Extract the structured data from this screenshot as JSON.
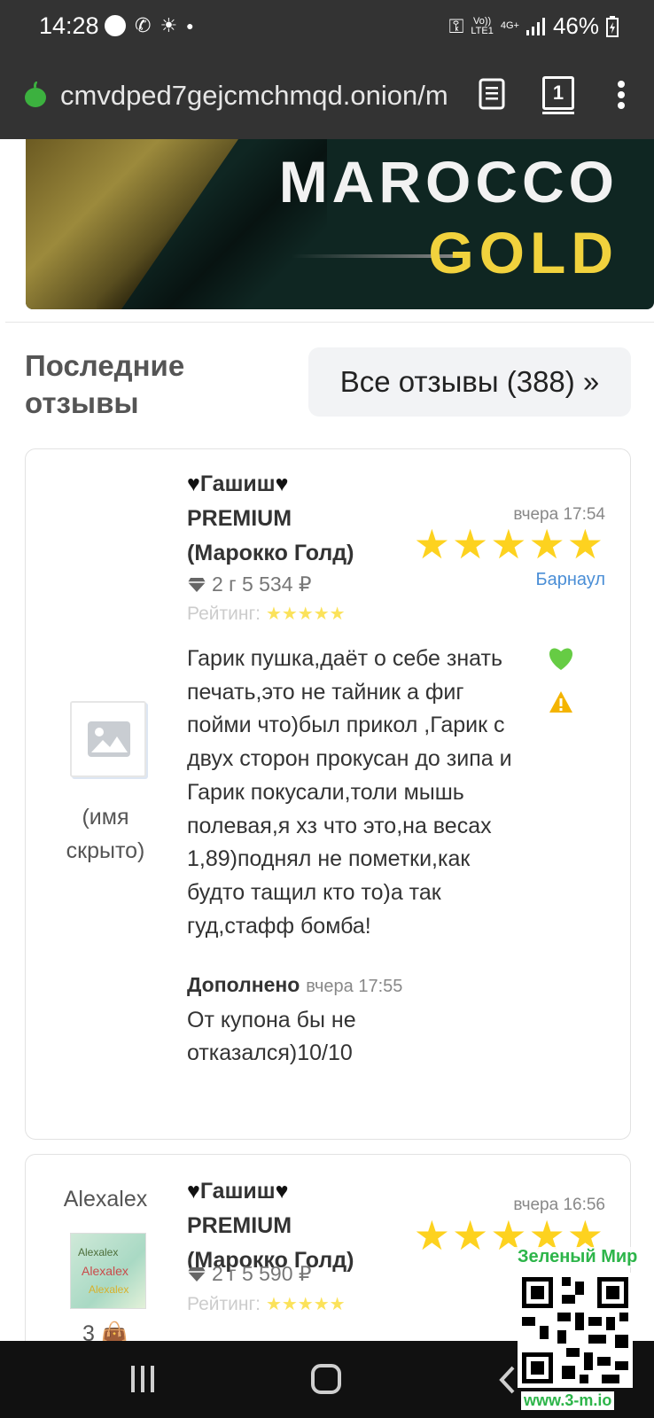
{
  "status_bar": {
    "time": "14:28",
    "network_top": "Vo))",
    "network_bottom": "LTE1",
    "net_type": "4G+",
    "battery": "46%"
  },
  "browser": {
    "url": "cmvdped7gejcmchmqd.onion/m",
    "tab_count": "1"
  },
  "banner": {
    "line1": "MAROCCO",
    "line2": "GOLD"
  },
  "reviews_section": {
    "title_line1": "Последние",
    "title_line2": "отзывы",
    "all_reviews_label": "Все отзывы (388) »"
  },
  "reviews": [
    {
      "user": "(имя скрыто)",
      "user_line1": "(имя",
      "user_line2": "скрыто)",
      "product_line1": "Гашиш",
      "product_line2": "PREMIUM",
      "product_line3": "(Марокко Голд)",
      "weight_price": "2 г 5 534 ₽",
      "rating_label": "Рейтинг:",
      "date": "вчера 17:54",
      "city": "Барнаул",
      "stars": 5,
      "text": "Гарик пушка,даёт о себе знать печать,это не тайник а фиг пойми что)был прикол ,Гарик с двух сторон прокусан до зипа и Гарик покусали,толи мышь полевая,я хз что это,на весах 1,89)поднял не пометки,как будто тащил кто то)а так гуд,стафф бомба!",
      "addon_label": "Дополнено",
      "addon_date": "вчера 17:55",
      "addon_text": "От купона бы не отказался)10/10"
    },
    {
      "user": "Alexalex",
      "avatar_text": "Alexalex",
      "product_line1": "Гашиш",
      "product_line2": "PREMIUM",
      "product_line3": "(Марокко Голд)",
      "weight_price": "2 г 5 590 ₽",
      "rating_label": "Рейтинг:",
      "date": "вчера 16:56",
      "stars": 5,
      "user_count": "3"
    }
  ],
  "watermark": {
    "title": "Зеленый Мир",
    "url": "www.3-m.io"
  },
  "colors": {
    "star": "#fdd21f",
    "city_link": "#4a8ed6",
    "like": "#66cc44",
    "warning": "#f4b400"
  }
}
